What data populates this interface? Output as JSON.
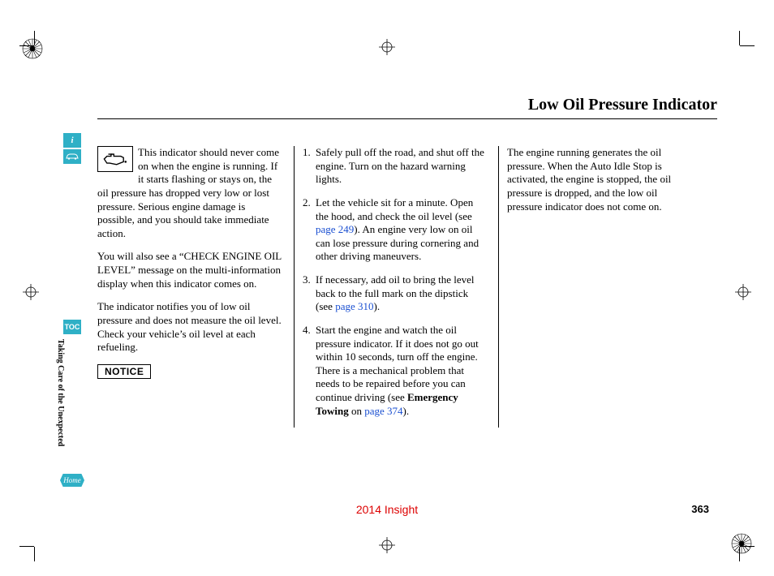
{
  "header": {
    "title": "Low Oil Pressure Indicator"
  },
  "sidebar": {
    "info_label": "i",
    "toc_label": "TOC",
    "home_label": "Home",
    "section_title": "Taking Care of the Unexpected"
  },
  "col1": {
    "p1": "This indicator should never come on when the engine is running. If it starts flashing or stays on, the oil pressure has dropped very low or lost pressure. Serious engine damage is possible, and you should take immediate action.",
    "p2": "You will also see a “CHECK ENGINE OIL LEVEL” message on the multi-information display when this indicator comes on.",
    "p3": "The indicator notifies you of low oil pressure and does not measure the oil level. Check your vehicle’s oil level at each refueling.",
    "notice": "NOTICE"
  },
  "steps": {
    "s1": "Safely pull off the road, and shut off the engine. Turn on the hazard warning lights.",
    "s2a": "Let the vehicle sit for a minute. Open the hood, and check the oil level (see ",
    "s2_link": "page 249",
    "s2b": "). An engine very low on oil can lose pressure during cornering and other driving maneuvers.",
    "s3a": "If necessary, add oil to bring the level back to the full mark on the dipstick (see ",
    "s3_link": "page 310",
    "s3b": ").",
    "s4a": "Start the engine and watch the oil pressure indicator. If it does not go out within 10 seconds, turn off the engine. There is a mechanical problem that needs to be repaired before you can continue driving (see ",
    "s4_bold": "Emergency Towing",
    "s4b": " on ",
    "s4_link": "page 374",
    "s4c": ")."
  },
  "col3": {
    "p1": "The engine running generates the oil pressure. When the Auto Idle Stop is activated, the engine is stopped, the oil pressure is dropped, and the low oil pressure indicator does not come on."
  },
  "footer": {
    "model": "2014 Insight",
    "page": "363"
  }
}
